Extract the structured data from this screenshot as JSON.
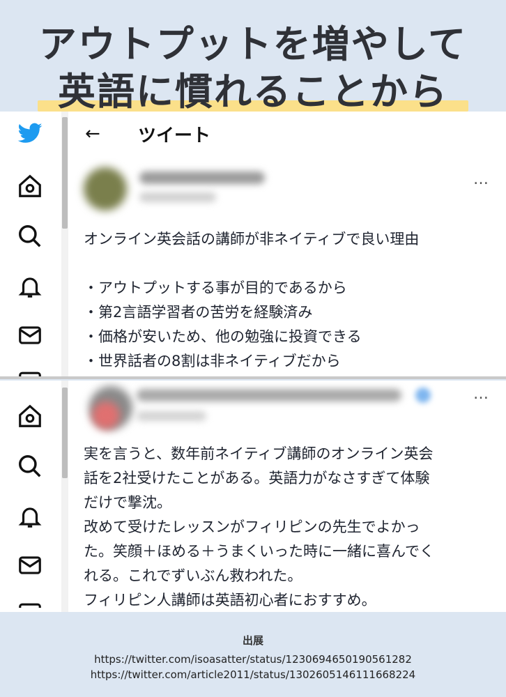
{
  "title": {
    "line1": "アウトプットを増やして",
    "line2": "英語に慣れることから"
  },
  "panel1": {
    "header_title": "ツイート",
    "back_icon": "left-arrow-icon",
    "more": "…",
    "tweet_lines": "オンライン英会話の講師が非ネイティブで良い理由\n\n・アウトプットする事が目的であるから\n・第2言語学習者の苦労を経験済み\n・価格が安いため、他の勉強に投資できる\n・世界話者の8割は非ネイティブだから",
    "sidebar_icons": [
      "twitter-bird-icon",
      "home-icon",
      "search-icon",
      "bell-icon",
      "mail-icon"
    ]
  },
  "panel2": {
    "more": "…",
    "tweet_lines": "実を言うと、数年前ネイティブ講師のオンライン英会\n話を2社受けたことがある。英語力がなさすぎて体験\nだけで撃沈。\n改めて受けたレッスンがフィリピンの先生でよかっ\nた。笑顔＋ほめる＋うまくいった時に一緒に喜んでく\nれる。これでずいぶん救われた。\nフィリピン人講師は英語初心者におすすめ。",
    "sidebar_icons": [
      "home-icon",
      "search-icon",
      "bell-icon",
      "mail-icon"
    ]
  },
  "footer": {
    "label": "出展",
    "url1": "https://twitter.com/isoasatter/status/1230694650190561282",
    "url2": "https://twitter.com/article2011/status/1302605146111668224"
  },
  "colors": {
    "background": "#dce6f2",
    "highlight": "#fbe08a",
    "twitter_blue": "#1d9bf0"
  }
}
